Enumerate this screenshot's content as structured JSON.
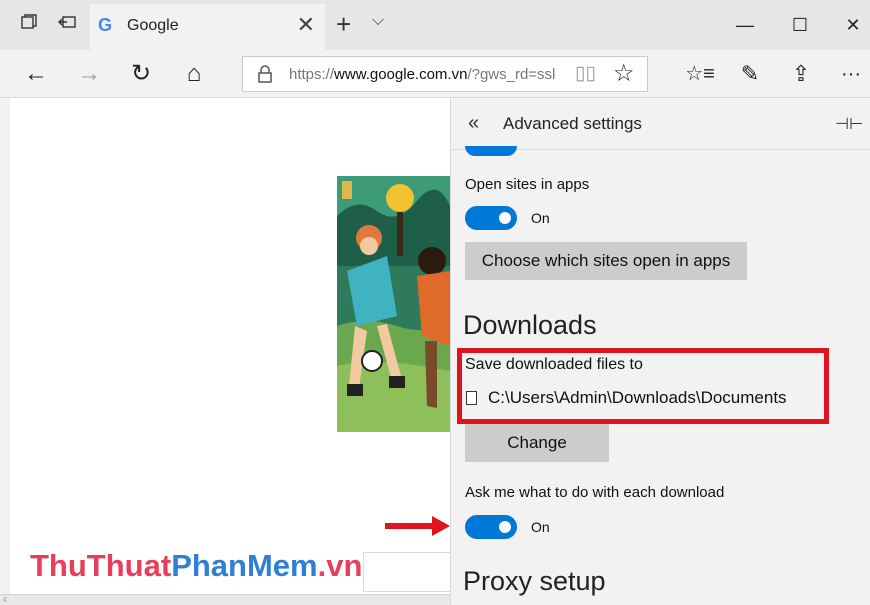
{
  "tab": {
    "favicon": "G",
    "title": "Google",
    "close": "✕"
  },
  "tabbar": {
    "new_tab": "+",
    "tab_list": "⌵",
    "minimize": "—",
    "maximize": "☐",
    "close": "✕"
  },
  "nav": {
    "back": "←",
    "forward": "→",
    "refresh": "↻",
    "home": "⌂",
    "url_prefix": "https://",
    "url_domain": "www.google.com.vn",
    "url_rest": "/?gws_rd=ssl",
    "reading_view": "▯▯",
    "favorite": "☆",
    "hub": "☆≡",
    "notes": "✎",
    "share": "⇪",
    "more": "···"
  },
  "page": {
    "watermark_part1": "ThuThuat",
    "watermark_part2": "PhanMem",
    "watermark_part3": ".vn",
    "scroll_left": "‹"
  },
  "settings": {
    "back_chevron": "«",
    "title": "Advanced settings",
    "pin": "⊣⊢",
    "open_sites_label": "Open sites in apps",
    "open_sites_state": "On",
    "choose_sites_button": "Choose which sites open in apps",
    "downloads_heading": "Downloads",
    "save_location_label": "Save downloaded files to",
    "save_location_path": "C:\\Users\\Admin\\Downloads\\Documents",
    "change_button": "Change",
    "ask_download_label": "Ask me what to do with each download",
    "ask_download_state": "On",
    "proxy_heading": "Proxy setup"
  },
  "colors": {
    "accent": "#0078d7",
    "highlight": "#e0141e",
    "watermark_red": "#e83e5c",
    "watermark_blue": "#2f7fd6"
  }
}
